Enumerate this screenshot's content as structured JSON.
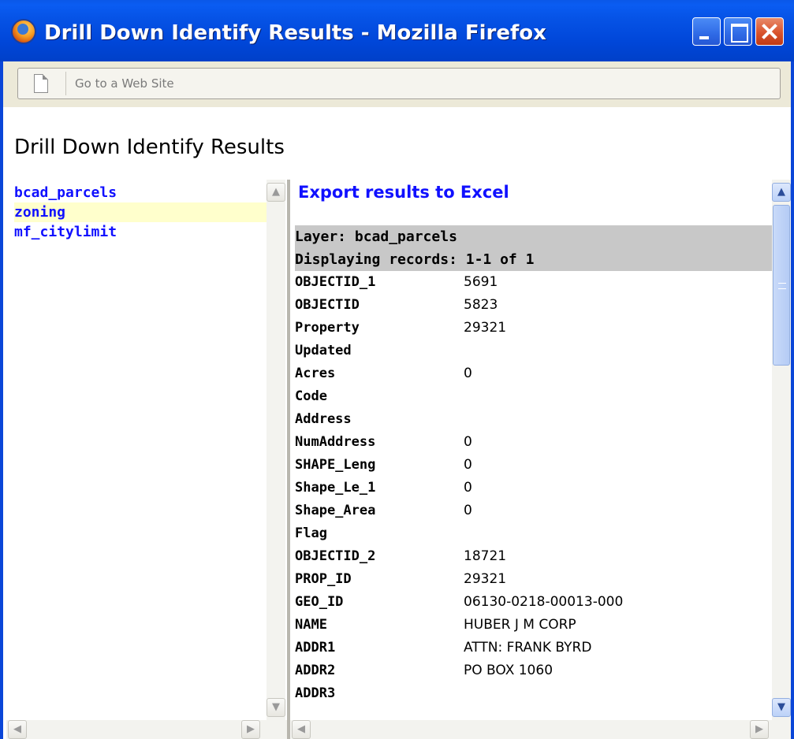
{
  "window": {
    "title": "Drill Down Identify Results - Mozilla Firefox",
    "buttons": [
      "minimize",
      "maximize",
      "close"
    ]
  },
  "address_bar": {
    "placeholder": "Go to a Web Site",
    "icon": "page-icon"
  },
  "page": {
    "title": "Drill Down Identify Results"
  },
  "layers": {
    "items": [
      {
        "label": "bcad_parcels",
        "active": false
      },
      {
        "label": "zoning",
        "active": true
      },
      {
        "label": "mf_citylimit",
        "active": false
      }
    ]
  },
  "results": {
    "export_label": "Export results to Excel",
    "layer_header": "Layer: bcad_parcels",
    "records_header": "Displaying records: 1-1 of 1",
    "fields": [
      {
        "key": "OBJECTID_1",
        "value": "5691"
      },
      {
        "key": "OBJECTID",
        "value": "5823"
      },
      {
        "key": "Property",
        "value": "29321"
      },
      {
        "key": "Updated",
        "value": ""
      },
      {
        "key": "Acres",
        "value": "0"
      },
      {
        "key": "Code",
        "value": ""
      },
      {
        "key": "Address",
        "value": ""
      },
      {
        "key": "NumAddress",
        "value": "0"
      },
      {
        "key": "SHAPE_Leng",
        "value": "0"
      },
      {
        "key": "Shape_Le_1",
        "value": "0"
      },
      {
        "key": "Shape_Area",
        "value": "0"
      },
      {
        "key": "Flag",
        "value": ""
      },
      {
        "key": "OBJECTID_2",
        "value": "18721"
      },
      {
        "key": "PROP_ID",
        "value": "29321"
      },
      {
        "key": "GEO_ID",
        "value": "06130-0218-00013-000"
      },
      {
        "key": "NAME",
        "value": "HUBER J M CORP"
      },
      {
        "key": "ADDR1",
        "value": "ATTN: FRANK BYRD"
      },
      {
        "key": "ADDR2",
        "value": "PO BOX 1060"
      },
      {
        "key": "ADDR3",
        "value": ""
      }
    ]
  },
  "colors": {
    "titlebar": "#0a52e4",
    "link": "#1010ff",
    "active_row": "#ffffcc",
    "header_row": "#c8c8c8"
  }
}
